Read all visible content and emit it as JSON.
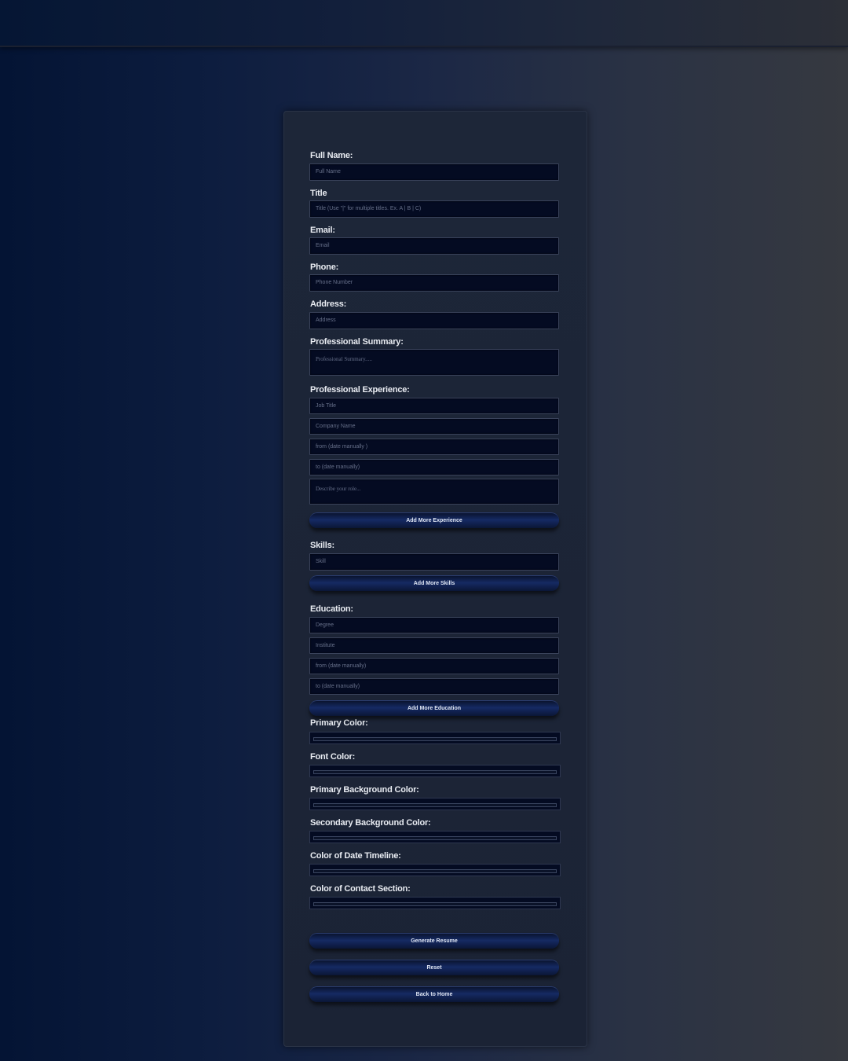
{
  "form": {
    "full_name": {
      "label": "Full Name:",
      "placeholder": "Full Name"
    },
    "title": {
      "label": "Title",
      "placeholder": "Title (Use \"|\" for multiple titles. Ex. A | B | C)"
    },
    "email": {
      "label": "Email:",
      "placeholder": "Email"
    },
    "phone": {
      "label": "Phone:",
      "placeholder": "Phone Number"
    },
    "address": {
      "label": "Address:",
      "placeholder": "Address"
    },
    "summary": {
      "label": "Professional Summary:",
      "placeholder": "Professional Summary....."
    },
    "experience": {
      "label": "Professional Experience:",
      "job_title": "Job Title",
      "company": "Company Name",
      "from": "from (date manually )",
      "to": "to (date manually)",
      "describe": "Describe your role...",
      "add_button": "Add More Experience"
    },
    "skills": {
      "label": "Skills:",
      "placeholder": "Skill",
      "add_button": "Add More Skills"
    },
    "education": {
      "label": "Education:",
      "degree": "Degree",
      "institute": "Institute",
      "from": "from (date manually)",
      "to": "to (date manually)",
      "add_button": "Add More Education"
    },
    "colors": {
      "primary": "Primary Color:",
      "font": "Font Color:",
      "primary_bg": "Primary Background Color:",
      "secondary_bg": "Secondary Background Color:",
      "timeline": "Color of Date Timeline:",
      "contact": "Color of Contact Section:"
    },
    "actions": {
      "generate": "Generate Resume",
      "reset": "Reset",
      "back": "Back to Home"
    }
  },
  "theme": {
    "accent": "#152a63",
    "input_bg": "#040b22",
    "card_bg": "#1d2638"
  }
}
